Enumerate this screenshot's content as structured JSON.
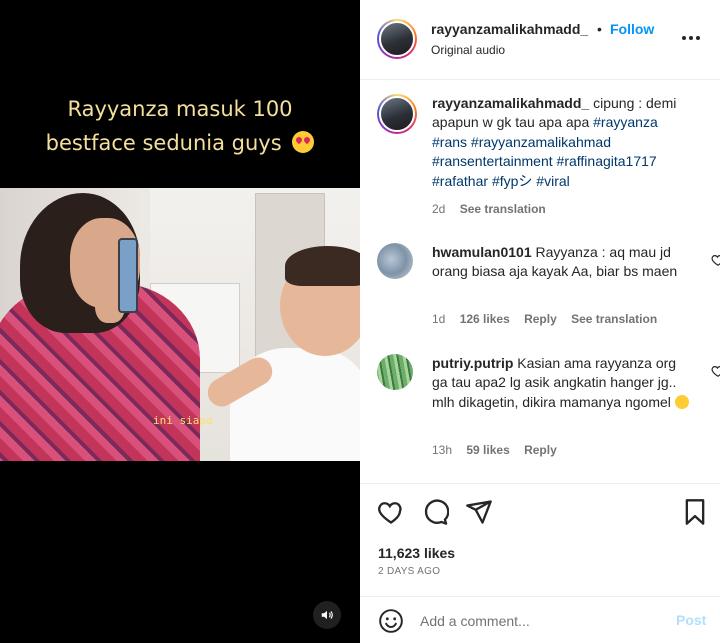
{
  "media": {
    "overlay_line1": "Rayyanza masuk 100",
    "overlay_line2": "bestface sedunia guys",
    "subtitle": "ini siapa",
    "sound_icon": "speaker-icon"
  },
  "header": {
    "username": "rayyanzamalikahmadd_",
    "separator": "•",
    "follow_label": "Follow",
    "audio": "Original audio",
    "more_icon": "more-horizontal-icon"
  },
  "caption": {
    "username": "rayyanzamalikahmadd_",
    "text": "cipung : demi apapun w gk tau apa apa",
    "tags": [
      "#rayyanza",
      "#rans",
      "#rayyanzamalikahmad",
      "#ransentertainment",
      "#raffinagita1717",
      "#rafathar",
      "#fypシ",
      "#viral"
    ],
    "time": "2d",
    "see_translation": "See translation"
  },
  "comments": [
    {
      "username": "hwamulan0101",
      "text": "Rayyanza : aq mau jd orang biasa aja kayak Aa, biar bs maen",
      "time": "1d",
      "likes": "126 likes",
      "reply": "Reply",
      "see_translation": "See translation"
    },
    {
      "username": "putriy.putrip",
      "text": "Kasian ama rayyanza org ga tau apa2 lg asik angkatin hanger jg.. mlh dikagetin, dikira mamanya ngomel",
      "time": "13h",
      "likes": "59 likes",
      "reply": "Reply"
    }
  ],
  "actions": {
    "icons": [
      "heart-icon",
      "comment-icon",
      "share-icon",
      "bookmark-icon"
    ],
    "likes": "11,623 likes",
    "date": "2 DAYS AGO"
  },
  "add_comment": {
    "placeholder": "Add a comment...",
    "post_label": "Post"
  },
  "colors": {
    "link": "#0095f6",
    "hashtag": "#00376b",
    "secondary": "#737373",
    "post_disabled": "#b2dffc"
  }
}
